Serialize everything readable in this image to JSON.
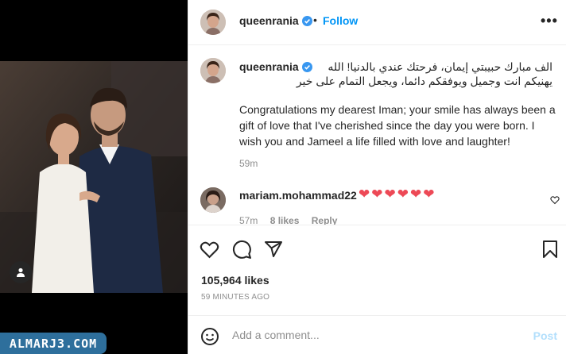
{
  "post": {
    "username": "queenrania",
    "follow_label": "Follow",
    "dot": "•",
    "more_label": "•••"
  },
  "caption": {
    "username": "queenrania",
    "arabic_line1": "الف مبارك حبيبتي إيمان، فرحتك عندي بالدنيا! الله",
    "arabic_line2": "يهنيكم انت وجميل ويوفقكم دائما، ويجعل التمام على خير",
    "english": "Congratulations my dearest Iman; your smile has always been a gift of love that I've cherished since the day you were born. I wish you and Jameel a life filled with love and laughter!",
    "time": "59m"
  },
  "comment": {
    "username": "mariam.mohammad22",
    "hearts": [
      "❤",
      "❤",
      "❤",
      "❤",
      "❤",
      "❤"
    ],
    "time": "57m",
    "likes": "8 likes",
    "reply": "Reply"
  },
  "stats": {
    "likes": "105,964 likes",
    "ago": "59 MINUTES AGO"
  },
  "add_comment": {
    "placeholder": "Add a comment...",
    "post_label": "Post"
  },
  "watermark": "ALMARJ3.COM",
  "icons": [
    "verified-badge-icon",
    "heart-icon",
    "comment-icon",
    "share-icon",
    "bookmark-icon",
    "emoji-icon",
    "user-tag-icon",
    "more-icon"
  ],
  "colors": {
    "accent": "#0095f6",
    "post_disabled": "#b2dffc",
    "heart_red": "#ed4956",
    "watermark_bg": "#2e6f9c",
    "muted": "#8e8e8e"
  }
}
